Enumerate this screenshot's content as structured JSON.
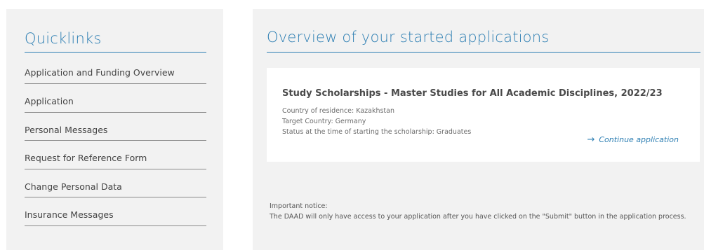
{
  "quicklinks": {
    "title": "Quicklinks",
    "items": [
      {
        "label": "Application and Funding Overview"
      },
      {
        "label": "Application"
      },
      {
        "label": "Personal Messages"
      },
      {
        "label": "Request for Reference Form"
      },
      {
        "label": "Change Personal Data"
      },
      {
        "label": "Insurance Messages"
      }
    ]
  },
  "overview": {
    "title": "Overview of your started applications",
    "application": {
      "name": "Study Scholarships - Master Studies for All Academic Disciplines, 2022/23",
      "country_of_residence": "Country of residence: Kazakhstan",
      "target_country": "Target Country: Germany",
      "status": "Status at the time of starting the scholarship: Graduates",
      "continue_label": "Continue application",
      "continue_icon": "arrow-right-icon"
    },
    "notice": {
      "heading": "Important notice:",
      "text": "The DAAD will only have access to your application after you have clicked on the \"Submit\" button in the application process."
    }
  },
  "colors": {
    "accent": "#2e7fb3",
    "panel_bg": "#f2f2f2",
    "card_bg": "#ffffff"
  }
}
